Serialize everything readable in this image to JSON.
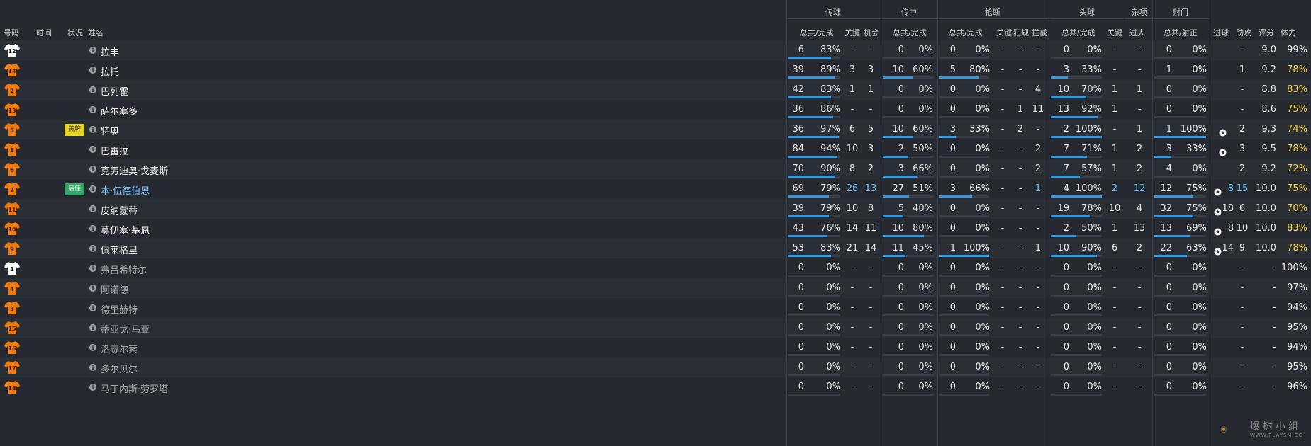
{
  "columns": {
    "number": "号码",
    "time": "时间",
    "status": "状况",
    "name": "姓名",
    "pass_total": "总共/完成",
    "pass_key": "关键",
    "pass_chance": "机会",
    "cross_total": "总共/完成",
    "tackle_total": "总共/完成",
    "tackle_key": "关键",
    "tackle_foul": "犯规",
    "tackle_block": "拦截",
    "header_total": "总共/完成",
    "header_key": "关键",
    "misc_dribble": "过人",
    "shot_total": "总共/射正",
    "goals": "进球",
    "assists": "助攻",
    "rating": "评分",
    "stamina": "体力"
  },
  "groups": {
    "passing": "传球",
    "crossing": "传中",
    "tackling": "抢断",
    "heading": "头球",
    "misc": "杂项",
    "shooting": "射门"
  },
  "colors": {
    "accent": "#2f9be8",
    "shirt": "#f07a0d",
    "highlight": "#6fc1f7",
    "stamina_low": "#f3cf4a",
    "badge_yellow": "#e8d61f",
    "badge_best": "#37a66a"
  },
  "watermark": {
    "text": "爆树小组",
    "sub": "WWW.PLAYSM.CC"
  },
  "players": [
    {
      "num": "12",
      "gk": true,
      "status": "",
      "name": "拉丰",
      "hl": false,
      "dim": false,
      "p": [
        "6",
        "83%",
        "-",
        "-"
      ],
      "c": [
        "0",
        "0%"
      ],
      "t": [
        "0",
        "0%",
        "-",
        "-",
        "-"
      ],
      "h": [
        "0",
        "0%",
        "-"
      ],
      "m": [
        "-"
      ],
      "s": [
        "0",
        "0%"
      ],
      "g": "",
      "a": "-",
      "r": "9.0",
      "st": "99%",
      "stc": "w",
      "hlcells": []
    },
    {
      "num": "14",
      "gk": false,
      "status": "",
      "name": "拉托",
      "hl": false,
      "dim": false,
      "p": [
        "39",
        "89%",
        "3",
        "3"
      ],
      "c": [
        "10",
        "60%"
      ],
      "t": [
        "5",
        "80%",
        "-",
        "-",
        "-"
      ],
      "h": [
        "3",
        "33%",
        "-"
      ],
      "m": [
        "-"
      ],
      "s": [
        "1",
        "0%"
      ],
      "g": "",
      "a": "1",
      "r": "9.2",
      "st": "78%",
      "stc": "y",
      "hlcells": []
    },
    {
      "num": "2",
      "gk": false,
      "status": "",
      "name": "巴列霍",
      "hl": false,
      "dim": false,
      "p": [
        "42",
        "83%",
        "1",
        "1"
      ],
      "c": [
        "0",
        "0%"
      ],
      "t": [
        "0",
        "0%",
        "-",
        "-",
        "4"
      ],
      "h": [
        "10",
        "70%",
        "1"
      ],
      "m": [
        "1"
      ],
      "s": [
        "0",
        "0%"
      ],
      "g": "",
      "a": "-",
      "r": "8.8",
      "st": "83%",
      "stc": "y",
      "hlcells": []
    },
    {
      "num": "13",
      "gk": false,
      "status": "",
      "name": "萨尔塞多",
      "hl": false,
      "dim": false,
      "p": [
        "36",
        "86%",
        "-",
        "-"
      ],
      "c": [
        "0",
        "0%"
      ],
      "t": [
        "0",
        "0%",
        "-",
        "1",
        "11"
      ],
      "h": [
        "13",
        "92%",
        "1"
      ],
      "m": [
        "-"
      ],
      "s": [
        "0",
        "0%"
      ],
      "g": "",
      "a": "-",
      "r": "8.6",
      "st": "75%",
      "stc": "y",
      "hlcells": []
    },
    {
      "num": "5",
      "gk": false,
      "status": "黄牌",
      "statusColor": "yellow",
      "name": "特奥",
      "hl": false,
      "dim": false,
      "p": [
        "36",
        "97%",
        "6",
        "5"
      ],
      "c": [
        "10",
        "60%"
      ],
      "t": [
        "3",
        "33%",
        "-",
        "2",
        "-"
      ],
      "h": [
        "2",
        "100%",
        "-"
      ],
      "m": [
        "1"
      ],
      "s": [
        "1",
        "100%"
      ],
      "g": "ball",
      "a": "2",
      "r": "9.3",
      "st": "74%",
      "stc": "y",
      "hlcells": []
    },
    {
      "num": "8",
      "gk": false,
      "status": "",
      "name": "巴雷拉",
      "hl": false,
      "dim": false,
      "p": [
        "84",
        "94%",
        "10",
        "3"
      ],
      "c": [
        "2",
        "50%"
      ],
      "t": [
        "0",
        "0%",
        "-",
        "-",
        "2"
      ],
      "h": [
        "7",
        "71%",
        "1"
      ],
      "m": [
        "2"
      ],
      "s": [
        "3",
        "33%"
      ],
      "g": "ball",
      "a": "3",
      "r": "9.5",
      "st": "78%",
      "stc": "y",
      "hlcells": []
    },
    {
      "num": "6",
      "gk": false,
      "status": "",
      "name": "克劳迪奥·戈麦斯",
      "hl": false,
      "dim": false,
      "p": [
        "70",
        "90%",
        "8",
        "2"
      ],
      "c": [
        "3",
        "66%"
      ],
      "t": [
        "0",
        "0%",
        "-",
        "-",
        "2"
      ],
      "h": [
        "7",
        "57%",
        "1"
      ],
      "m": [
        "2"
      ],
      "s": [
        "4",
        "0%"
      ],
      "g": "",
      "a": "2",
      "r": "9.2",
      "st": "72%",
      "stc": "y",
      "hlcells": []
    },
    {
      "num": "7",
      "gk": false,
      "status": "最佳",
      "statusColor": "green",
      "name": "本·伍德伯恩",
      "hl": true,
      "dim": false,
      "p": [
        "69",
        "79%",
        "26",
        "13"
      ],
      "c": [
        "27",
        "51%"
      ],
      "t": [
        "3",
        "66%",
        "-",
        "-",
        "1"
      ],
      "h": [
        "4",
        "100%",
        "2"
      ],
      "m": [
        "12"
      ],
      "s": [
        "12",
        "75%"
      ],
      "g": "8",
      "a": "15",
      "r": "10.0",
      "st": "75%",
      "stc": "y",
      "hlcells": [
        "pk",
        "pc",
        "tb",
        "hk",
        "m0",
        "a",
        "g"
      ]
    },
    {
      "num": "11",
      "gk": false,
      "status": "",
      "name": "皮纳蒙蒂",
      "hl": false,
      "dim": false,
      "p": [
        "39",
        "79%",
        "10",
        "8"
      ],
      "c": [
        "5",
        "40%"
      ],
      "t": [
        "0",
        "0%",
        "-",
        "-",
        "-"
      ],
      "h": [
        "19",
        "78%",
        "10"
      ],
      "m": [
        "4"
      ],
      "s": [
        "32",
        "75%"
      ],
      "g": "18",
      "a": "6",
      "r": "10.0",
      "st": "70%",
      "stc": "y",
      "hlcells": []
    },
    {
      "num": "10",
      "gk": false,
      "status": "",
      "name": "莫伊塞·基恩",
      "hl": false,
      "dim": false,
      "p": [
        "43",
        "76%",
        "14",
        "11"
      ],
      "c": [
        "10",
        "80%"
      ],
      "t": [
        "0",
        "0%",
        "-",
        "-",
        "-"
      ],
      "h": [
        "2",
        "50%",
        "1"
      ],
      "m": [
        "13"
      ],
      "s": [
        "13",
        "69%"
      ],
      "g": "8",
      "a": "10",
      "r": "10.0",
      "st": "83%",
      "stc": "y",
      "hlcells": []
    },
    {
      "num": "9",
      "gk": false,
      "status": "",
      "name": "佩莱格里",
      "hl": false,
      "dim": false,
      "p": [
        "53",
        "83%",
        "21",
        "14"
      ],
      "c": [
        "11",
        "45%"
      ],
      "t": [
        "1",
        "100%",
        "-",
        "-",
        "1"
      ],
      "h": [
        "10",
        "90%",
        "6"
      ],
      "m": [
        "2"
      ],
      "s": [
        "22",
        "63%"
      ],
      "g": "14",
      "a": "9",
      "r": "10.0",
      "st": "78%",
      "stc": "y",
      "hlcells": []
    },
    {
      "num": "1",
      "gk": true,
      "status": "",
      "name": "弗吕希特尔",
      "hl": false,
      "dim": true,
      "p": [
        "0",
        "0%",
        "-",
        "-"
      ],
      "c": [
        "0",
        "0%"
      ],
      "t": [
        "0",
        "0%",
        "-",
        "-",
        "-"
      ],
      "h": [
        "0",
        "0%",
        "-"
      ],
      "m": [
        "-"
      ],
      "s": [
        "0",
        "0%"
      ],
      "g": "",
      "a": "-",
      "r": "-",
      "st": "100%",
      "stc": "w",
      "hlcells": []
    },
    {
      "num": "4",
      "gk": false,
      "status": "",
      "name": "阿诺德",
      "hl": false,
      "dim": true,
      "p": [
        "0",
        "0%",
        "-",
        "-"
      ],
      "c": [
        "0",
        "0%"
      ],
      "t": [
        "0",
        "0%",
        "-",
        "-",
        "-"
      ],
      "h": [
        "0",
        "0%",
        "-"
      ],
      "m": [
        "-"
      ],
      "s": [
        "0",
        "0%"
      ],
      "g": "",
      "a": "-",
      "r": "-",
      "st": "97%",
      "stc": "w",
      "hlcells": []
    },
    {
      "num": "3",
      "gk": false,
      "status": "",
      "name": "德里赫特",
      "hl": false,
      "dim": true,
      "p": [
        "0",
        "0%",
        "-",
        "-"
      ],
      "c": [
        "0",
        "0%"
      ],
      "t": [
        "0",
        "0%",
        "-",
        "-",
        "-"
      ],
      "h": [
        "0",
        "0%",
        "-"
      ],
      "m": [
        "-"
      ],
      "s": [
        "0",
        "0%"
      ],
      "g": "",
      "a": "-",
      "r": "-",
      "st": "94%",
      "stc": "w",
      "hlcells": []
    },
    {
      "num": "15",
      "gk": false,
      "status": "",
      "name": "蒂亚戈·马亚",
      "hl": false,
      "dim": true,
      "p": [
        "0",
        "0%",
        "-",
        "-"
      ],
      "c": [
        "0",
        "0%"
      ],
      "t": [
        "0",
        "0%",
        "-",
        "-",
        "-"
      ],
      "h": [
        "0",
        "0%",
        "-"
      ],
      "m": [
        "-"
      ],
      "s": [
        "0",
        "0%"
      ],
      "g": "",
      "a": "-",
      "r": "-",
      "st": "95%",
      "stc": "w",
      "hlcells": []
    },
    {
      "num": "16",
      "gk": false,
      "status": "",
      "name": "洛赛尔索",
      "hl": false,
      "dim": true,
      "p": [
        "0",
        "0%",
        "-",
        "-"
      ],
      "c": [
        "0",
        "0%"
      ],
      "t": [
        "0",
        "0%",
        "-",
        "-",
        "-"
      ],
      "h": [
        "0",
        "0%",
        "-"
      ],
      "m": [
        "-"
      ],
      "s": [
        "0",
        "0%"
      ],
      "g": "",
      "a": "-",
      "r": "-",
      "st": "94%",
      "stc": "w",
      "hlcells": []
    },
    {
      "num": "17",
      "gk": false,
      "status": "",
      "name": "多尔贝尔",
      "hl": false,
      "dim": true,
      "p": [
        "0",
        "0%",
        "-",
        "-"
      ],
      "c": [
        "0",
        "0%"
      ],
      "t": [
        "0",
        "0%",
        "-",
        "-",
        "-"
      ],
      "h": [
        "0",
        "0%",
        "-"
      ],
      "m": [
        "-"
      ],
      "s": [
        "0",
        "0%"
      ],
      "g": "",
      "a": "-",
      "r": "-",
      "st": "95%",
      "stc": "w",
      "hlcells": []
    },
    {
      "num": "18",
      "gk": false,
      "status": "",
      "name": "马丁内斯·劳罗塔",
      "hl": false,
      "dim": true,
      "p": [
        "0",
        "0%",
        "-",
        "-"
      ],
      "c": [
        "0",
        "0%"
      ],
      "t": [
        "0",
        "0%",
        "-",
        "-",
        "-"
      ],
      "h": [
        "0",
        "0%",
        "-"
      ],
      "m": [
        "-"
      ],
      "s": [
        "0",
        "0%"
      ],
      "g": "",
      "a": "-",
      "r": "-",
      "st": "96%",
      "stc": "w",
      "hlcells": []
    }
  ]
}
